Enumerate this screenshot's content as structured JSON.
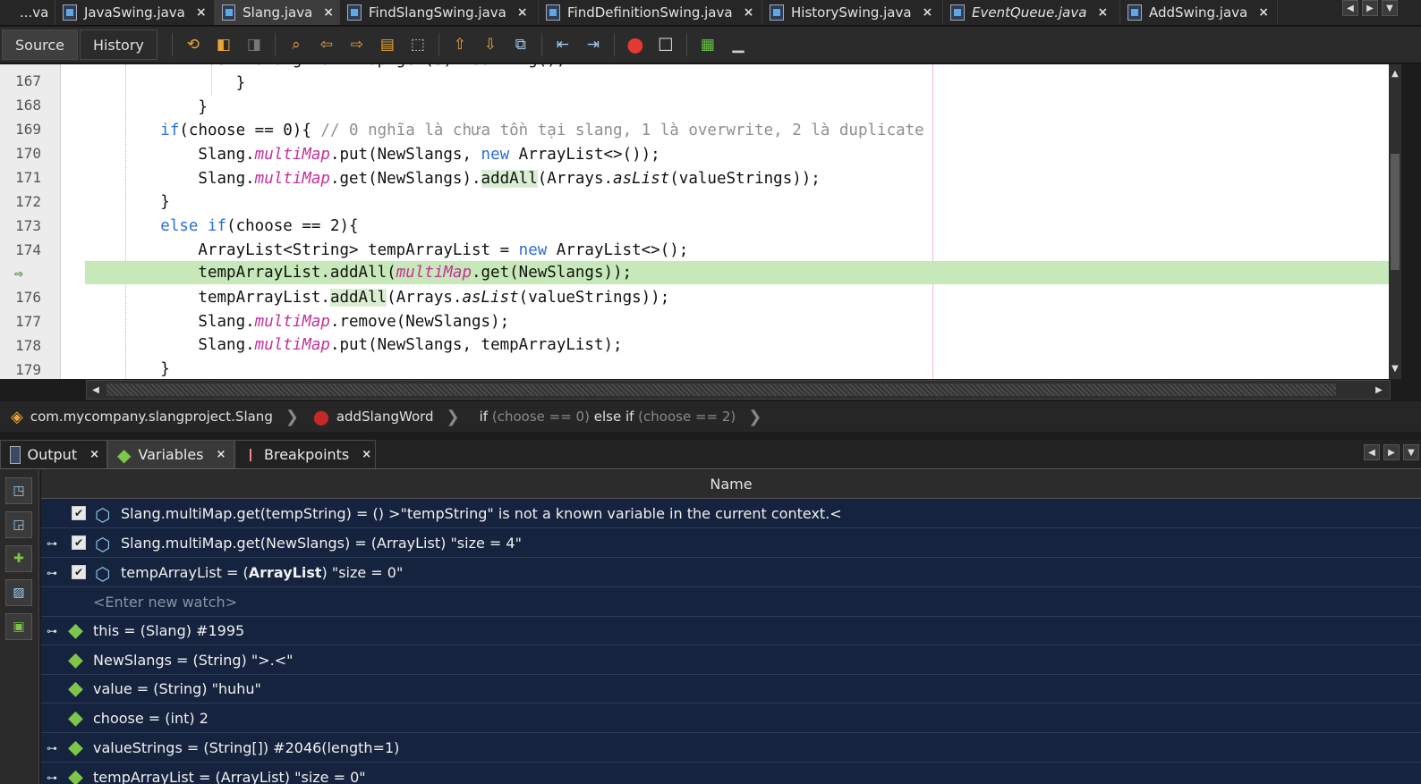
{
  "editor_tabs": [
    {
      "label": "...va",
      "active": false,
      "close": ""
    },
    {
      "label": "JavaSwing.java",
      "active": false,
      "close": "×"
    },
    {
      "label": "Slang.java",
      "active": true,
      "close": "×"
    },
    {
      "label": "FindSlangSwing.java",
      "active": false,
      "close": "×"
    },
    {
      "label": "FindDefinitionSwing.java",
      "active": false,
      "close": "×"
    },
    {
      "label": "HistorySwing.java",
      "active": false,
      "close": "×"
    },
    {
      "label": "EventQueue.java",
      "active": false,
      "italic": true,
      "close": "×"
    },
    {
      "label": "AddSwing.java",
      "active": false,
      "close": "×"
    }
  ],
  "toolbar": {
    "source_label": "Source",
    "history_label": "History"
  },
  "code": {
    "line_numbers": [
      "167",
      "168",
      "169",
      "170",
      "171",
      "172",
      "173",
      "174",
      "",
      "176",
      "177",
      "178",
      "179"
    ],
    "current_line_marker": "⇨"
  },
  "breadcrumb": {
    "class_path": "com.mycompany.slangproject.Slang",
    "method": "addSlangWord",
    "cond_if": "if",
    "cond_if_expr": "(choose == 0)",
    "cond_else_if": "else if",
    "cond_else_expr": "(choose == 2)"
  },
  "panel_tabs": [
    {
      "label": "Output",
      "close": "×"
    },
    {
      "label": "Variables",
      "close": "×"
    },
    {
      "label": "Breakpoints",
      "close": "×"
    }
  ],
  "variables": {
    "column_header": "Name",
    "watches": [
      "Slang.multiMap.get(tempString) = () >\"tempString\" is not a known variable in the current context.<",
      "Slang.multiMap.get(NewSlangs) = (ArrayList) \"size = 4\""
    ],
    "watch3_pre": "tempArrayList = (",
    "watch3_bold": "ArrayList",
    "watch3_post": ") \"size = 0\"",
    "new_watch_placeholder": "<Enter new watch>",
    "locals": [
      "this = (Slang) #1995",
      "NewSlangs = (String) \">.<\"",
      "value = (String) \"huhu\"",
      "choose = (int) 2",
      "valueStrings = (String[]) #2046(length=1)",
      "tempArrayList = (ArrayList) \"size = 0\""
    ]
  },
  "colors": {
    "current_line": "#c7e8b8",
    "keyword": "#2b6ed3",
    "static_field": "#c3319b",
    "comment": "#8f8f8f",
    "variables_bg": "#15233e"
  }
}
